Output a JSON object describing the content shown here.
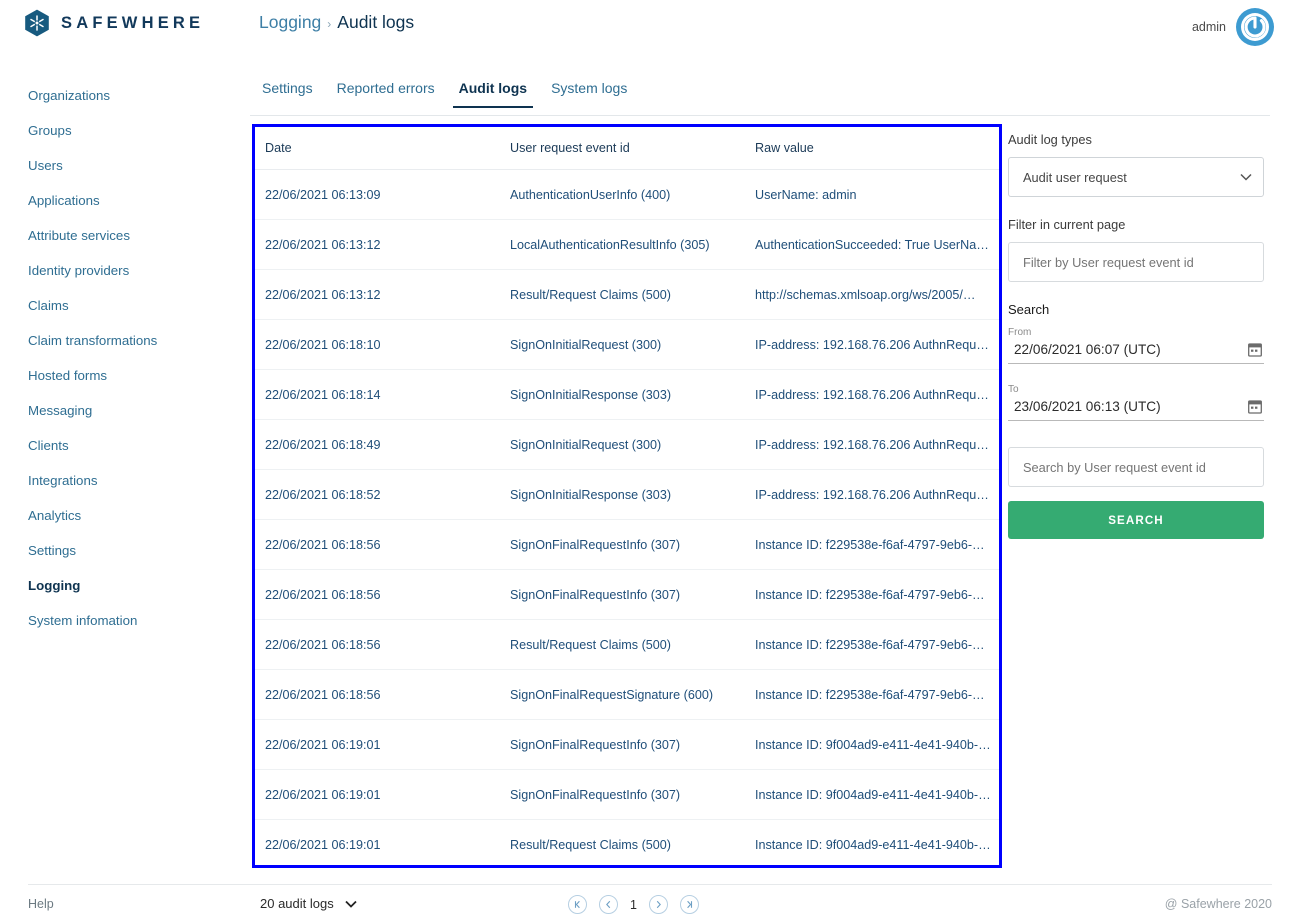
{
  "header": {
    "brand_name": "SAFEWHERE",
    "logo_icon": "safewhere-hexagon-logo",
    "breadcrumb_parent": "Logging",
    "breadcrumb_separator": "›",
    "breadcrumb_current": "Audit logs",
    "user_name": "admin",
    "avatar_icon": "power-avatar-icon"
  },
  "sidebar": {
    "items": [
      {
        "label": "Organizations",
        "active": false
      },
      {
        "label": "Groups",
        "active": false
      },
      {
        "label": "Users",
        "active": false
      },
      {
        "label": "Applications",
        "active": false
      },
      {
        "label": "Attribute services",
        "active": false
      },
      {
        "label": "Identity providers",
        "active": false
      },
      {
        "label": "Claims",
        "active": false
      },
      {
        "label": "Claim transformations",
        "active": false
      },
      {
        "label": "Hosted forms",
        "active": false
      },
      {
        "label": "Messaging",
        "active": false
      },
      {
        "label": "Clients",
        "active": false
      },
      {
        "label": "Integrations",
        "active": false
      },
      {
        "label": "Analytics",
        "active": false
      },
      {
        "label": "Settings",
        "active": false
      },
      {
        "label": "Logging",
        "active": true
      },
      {
        "label": "System infomation",
        "active": false
      }
    ]
  },
  "tabs": [
    {
      "label": "Settings",
      "active": false
    },
    {
      "label": "Reported errors",
      "active": false
    },
    {
      "label": "Audit logs",
      "active": true
    },
    {
      "label": "System logs",
      "active": false
    }
  ],
  "table": {
    "highlight_border_color": "#0000ff",
    "columns": [
      "Date",
      "User request event id",
      "Raw value"
    ],
    "rows": [
      [
        "22/06/2021 06:13:09",
        "AuthenticationUserInfo (400)",
        "UserName: admin"
      ],
      [
        "22/06/2021 06:13:12",
        "LocalAuthenticationResultInfo (305)",
        "AuthenticationSucceeded: True UserNa…"
      ],
      [
        "22/06/2021 06:13:12",
        "Result/Request Claims (500)",
        "http://schemas.xmlsoap.org/ws/2005/…"
      ],
      [
        "22/06/2021 06:18:10",
        "SignOnInitialRequest (300)",
        "IP-address: 192.168.76.206 AuthnRequ…"
      ],
      [
        "22/06/2021 06:18:14",
        "SignOnInitialResponse (303)",
        "IP-address: 192.168.76.206 AuthnRequ…"
      ],
      [
        "22/06/2021 06:18:49",
        "SignOnInitialRequest (300)",
        "IP-address: 192.168.76.206 AuthnRequ…"
      ],
      [
        "22/06/2021 06:18:52",
        "SignOnInitialResponse (303)",
        "IP-address: 192.168.76.206 AuthnRequ…"
      ],
      [
        "22/06/2021 06:18:56",
        "SignOnFinalRequestInfo (307)",
        "Instance ID: f229538e-f6af-4797-9eb6-…"
      ],
      [
        "22/06/2021 06:18:56",
        "SignOnFinalRequestInfo (307)",
        "Instance ID: f229538e-f6af-4797-9eb6-…"
      ],
      [
        "22/06/2021 06:18:56",
        "Result/Request Claims (500)",
        "Instance ID: f229538e-f6af-4797-9eb6-…"
      ],
      [
        "22/06/2021 06:18:56",
        "SignOnFinalRequestSignature (600)",
        "Instance ID: f229538e-f6af-4797-9eb6-…"
      ],
      [
        "22/06/2021 06:19:01",
        "SignOnFinalRequestInfo (307)",
        "Instance ID: 9f004ad9-e411-4e41-940b-…"
      ],
      [
        "22/06/2021 06:19:01",
        "SignOnFinalRequestInfo (307)",
        "Instance ID: 9f004ad9-e411-4e41-940b-…"
      ],
      [
        "22/06/2021 06:19:01",
        "Result/Request Claims (500)",
        "Instance ID: 9f004ad9-e411-4e41-940b-…"
      ]
    ]
  },
  "rightpanel": {
    "log_types_label": "Audit log types",
    "log_types_value": "Audit user request",
    "log_types_options": [
      "Audit user request"
    ],
    "filter_label": "Filter in current page",
    "filter_placeholder": "Filter by User request event id",
    "filter_value": "",
    "search_title": "Search",
    "from_caption": "From",
    "from_value": "22/06/2021 06:07 (UTC)",
    "to_caption": "To",
    "to_value": "23/06/2021 06:13 (UTC)",
    "search_placeholder": "Search by User request event id",
    "search_value": "",
    "search_button_label": "SEARCH",
    "search_button_color": "#35ab72",
    "calendar_icon": "calendar-icon",
    "chevron_icon": "chevron-down-icon"
  },
  "footer": {
    "help_label": "Help",
    "per_page_label": "20 audit logs",
    "per_page_chevron": "chevron-down-icon",
    "page_number": "1",
    "first_icon": "first-page-icon",
    "prev_icon": "previous-page-icon",
    "next_icon": "next-page-icon",
    "last_icon": "last-page-icon",
    "copyright": "@ Safewhere 2020"
  }
}
